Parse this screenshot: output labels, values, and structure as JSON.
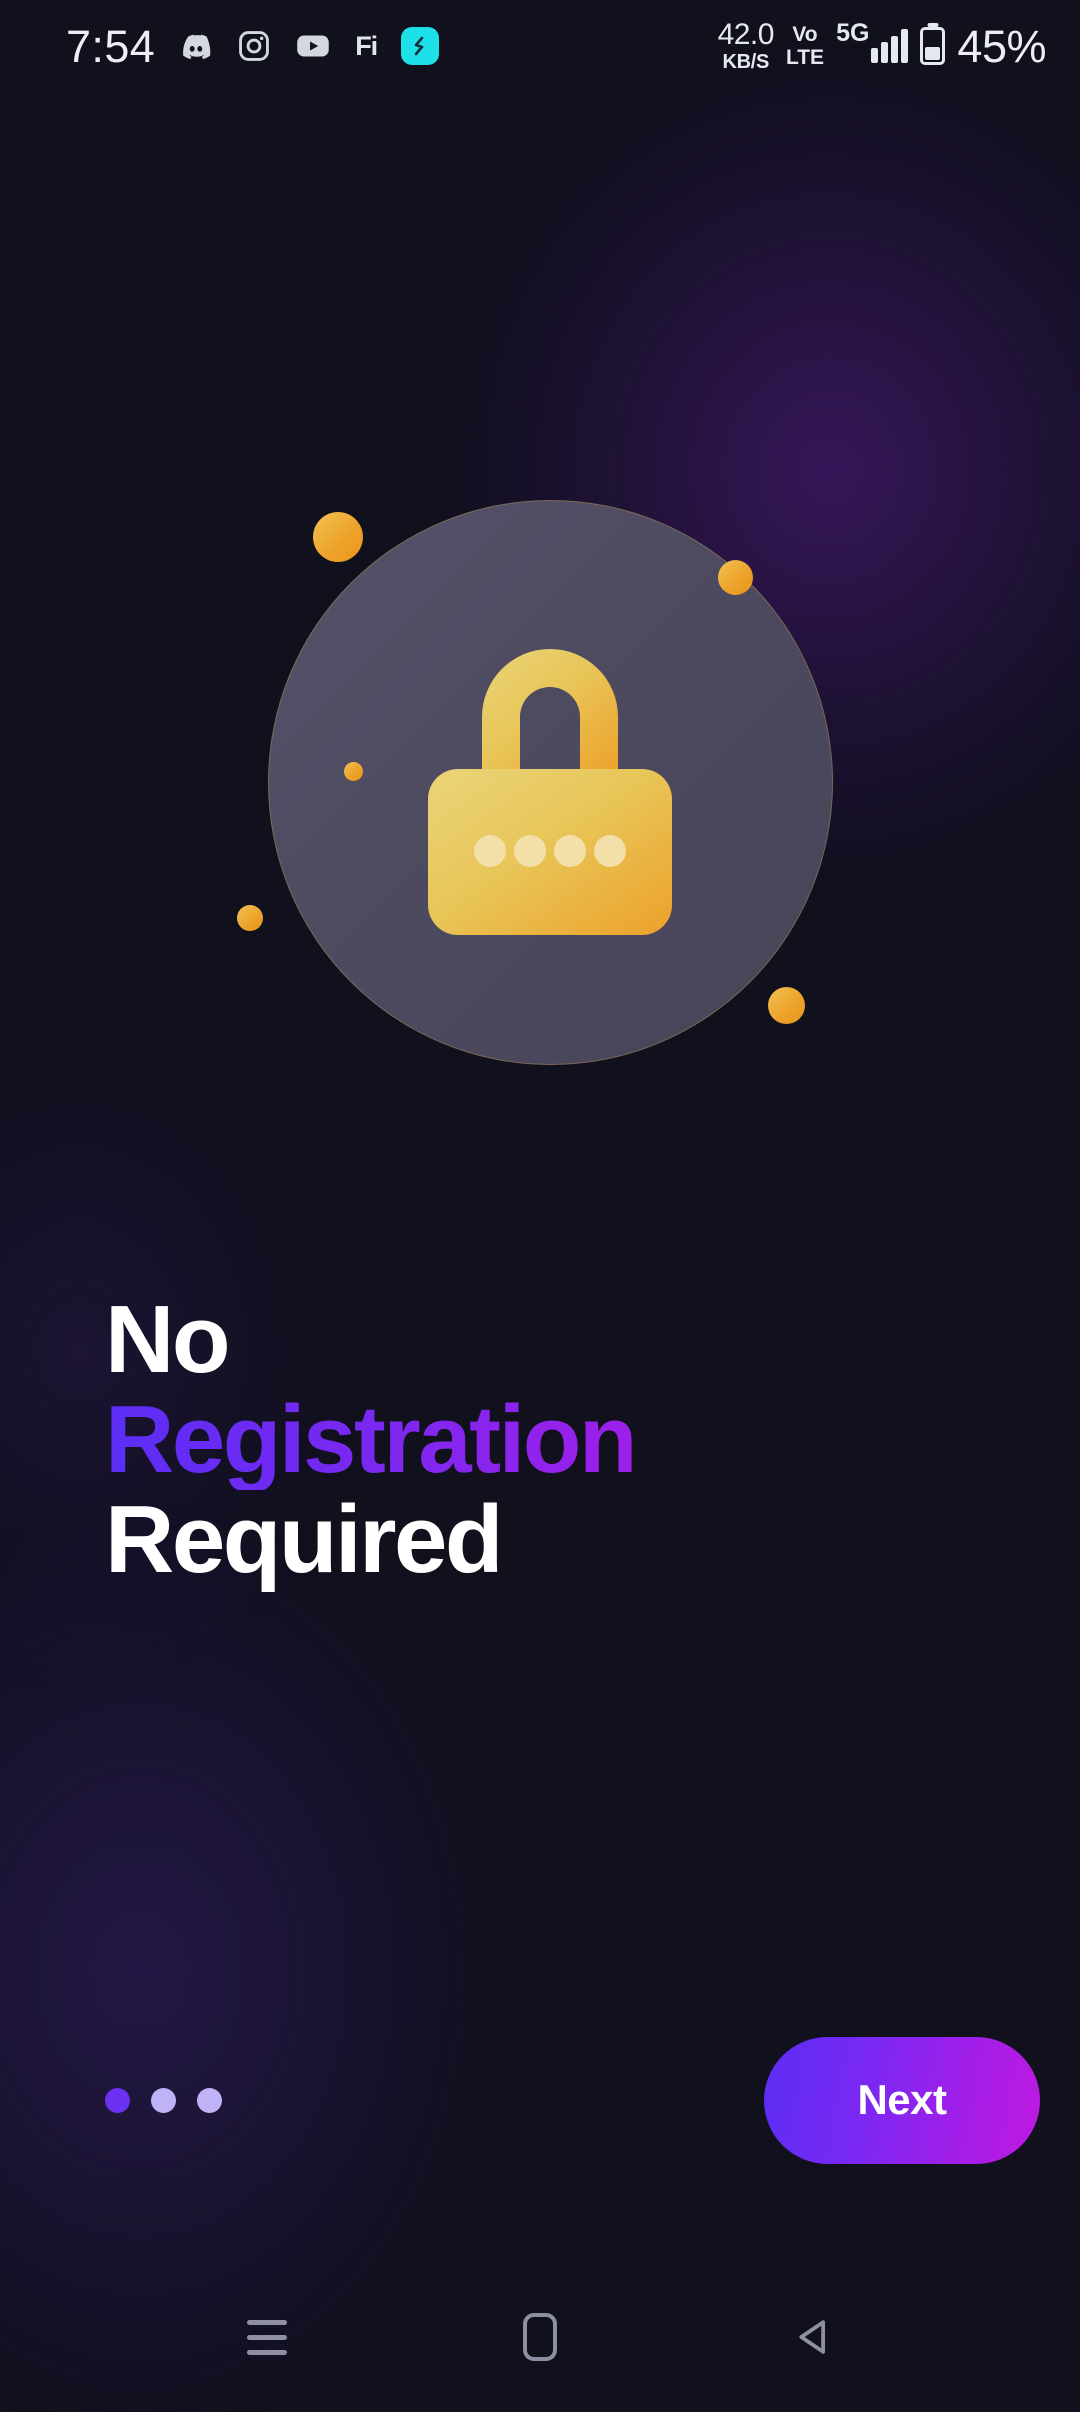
{
  "status_bar": {
    "clock": "7:54",
    "tray_icons": [
      {
        "name": "discord-icon",
        "label": "Discord"
      },
      {
        "name": "instagram-icon",
        "label": "Instagram"
      },
      {
        "name": "youtube-icon",
        "label": "YouTube"
      },
      {
        "name": "fi-icon",
        "label": "Fi"
      },
      {
        "name": "app-shortcut-icon",
        "label": "S"
      }
    ],
    "network_speed_value": "42.0",
    "network_speed_unit": "KB/S",
    "volte_top": "Vo",
    "volte_bottom": "LTE",
    "network_type": "5G",
    "signal_bars": 4,
    "battery_percent": "45%",
    "battery_level": 45
  },
  "illustration": {
    "icon_name": "padlock-icon",
    "circle_color": "#4d4a5f",
    "lock_gradient_start": "#e9d279",
    "lock_gradient_end": "#eda32a",
    "dot_count": 4,
    "accent_dot_color": "#eda42c",
    "accent_dots": 5
  },
  "headline": {
    "line1": "No",
    "line2": "Registration",
    "line3": "Required",
    "line2_gradient_start": "#5b2ef5",
    "line2_gradient_end": "#d315e8",
    "plain_color": "#ffffff"
  },
  "footer": {
    "next_label": "Next",
    "next_gradient_start": "#5b2ef5",
    "next_gradient_end": "#c01ae0",
    "pager": {
      "total": 3,
      "active_index": 0,
      "active_color": "#6b30f0",
      "inactive_color": "#c0b2f7"
    }
  },
  "nav_bar": {
    "recents_label": "Recents",
    "home_label": "Home",
    "back_label": "Back",
    "tint": "#8e8fa3"
  }
}
